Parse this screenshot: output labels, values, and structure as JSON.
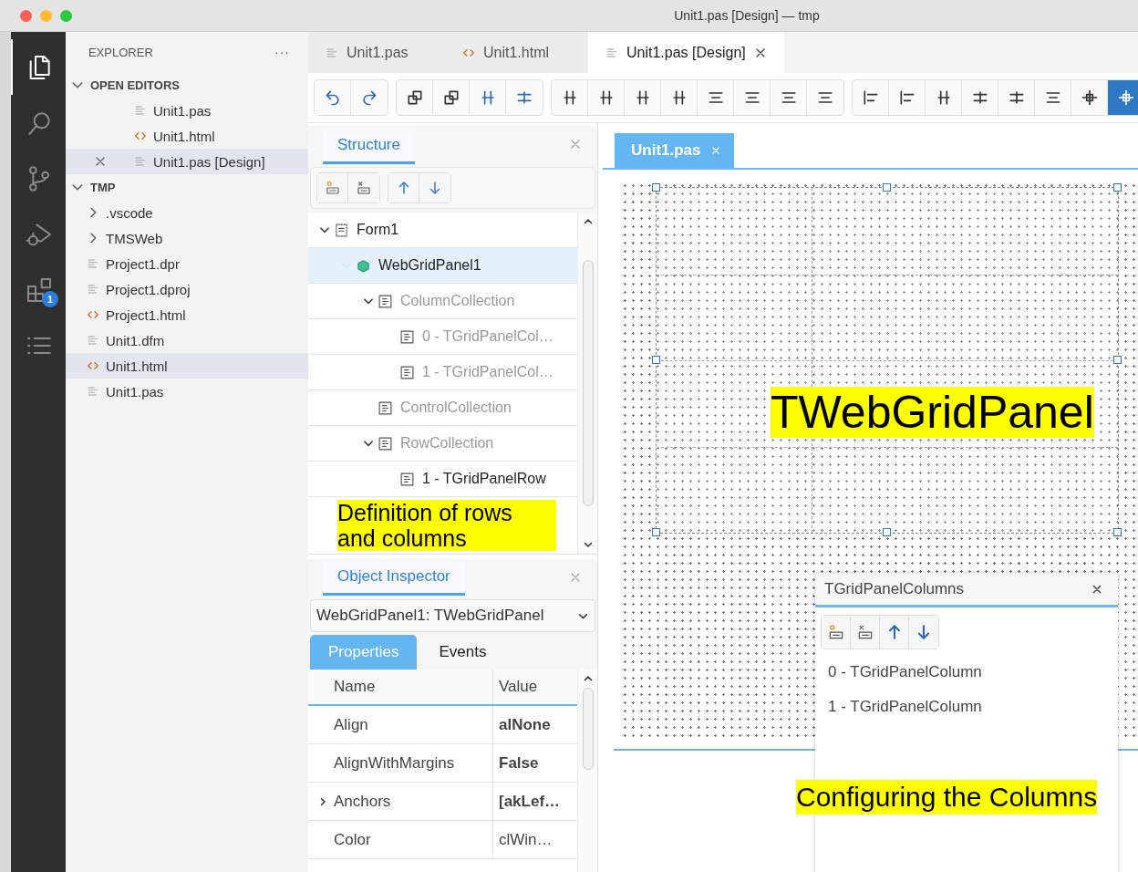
{
  "window": {
    "title": "Unit1.pas [Design] — tmp"
  },
  "activity_bar": {
    "items": [
      {
        "selected": true
      },
      {
        "selected": false
      },
      {
        "selected": false
      },
      {
        "selected": false
      },
      {
        "selected": false,
        "badge": "1"
      },
      {
        "selected": false
      }
    ]
  },
  "explorer": {
    "title": "EXPLORER",
    "more": "···",
    "sections": [
      {
        "kind": "editors",
        "title": "OPEN EDITORS",
        "expanded": true,
        "items": [
          {
            "kind": "file",
            "name": "Unit1.pas",
            "selected": false
          },
          {
            "kind": "html",
            "name": "Unit1.html",
            "selected": false
          },
          {
            "kind": "file",
            "name": "Unit1.pas [Design]",
            "selected": true
          }
        ]
      },
      {
        "kind": "folder",
        "title": "TMP",
        "expanded": true,
        "items": [
          {
            "kind": "folder",
            "name": ".vscode",
            "selected": false
          },
          {
            "kind": "folder",
            "name": "TMSWeb",
            "selected": false
          },
          {
            "kind": "file",
            "name": "Project1.dpr",
            "selected": false
          },
          {
            "kind": "file",
            "name": "Project1.dproj",
            "selected": false
          },
          {
            "kind": "html",
            "name": "Project1.html",
            "selected": false
          },
          {
            "kind": "file",
            "name": "Unit1.dfm",
            "selected": false
          },
          {
            "kind": "html",
            "name": "Unit1.html",
            "selected": true
          },
          {
            "kind": "file",
            "name": "Unit1.pas",
            "selected": false
          }
        ]
      }
    ]
  },
  "editor_tabs": [
    {
      "kind": "file",
      "label": "Unit1.pas",
      "selected": false
    },
    {
      "kind": "html",
      "label": "Unit1.html",
      "selected": false
    },
    {
      "kind": "file",
      "label": "Unit1.pas [Design]",
      "selected": true
    }
  ],
  "toolbar": {
    "groups": [
      {
        "buttons": [
          {
            "selected": false
          },
          {
            "selected": false
          }
        ]
      },
      {
        "buttons": [
          {
            "selected": false
          },
          {
            "selected": false
          },
          {
            "selected": false
          },
          {
            "selected": false
          }
        ]
      },
      {
        "buttons": [
          {
            "selected": false
          },
          {
            "selected": false
          },
          {
            "selected": false
          },
          {
            "selected": false
          },
          {
            "selected": false
          },
          {
            "selected": false
          },
          {
            "selected": false
          },
          {
            "selected": false
          }
        ]
      },
      {
        "buttons": [
          {
            "selected": false
          },
          {
            "selected": false
          },
          {
            "selected": false
          },
          {
            "selected": false
          },
          {
            "selected": false
          },
          {
            "selected": false
          },
          {
            "selected": false
          },
          {
            "selected": true
          }
        ]
      }
    ]
  },
  "structure": {
    "tab": "Structure",
    "tree": [
      {
        "label": "Form1",
        "kind": "form",
        "expanded": true,
        "selected": false,
        "greyed": false,
        "children": [
          {
            "label": "WebGridPanel1",
            "kind": "panel",
            "expanded": true,
            "selected": true,
            "greyed": false,
            "children": [
              {
                "label": "ColumnCollection",
                "kind": "collection",
                "expanded": true,
                "selected": false,
                "greyed": true,
                "children": [
                  {
                    "label": "0 - TGridPanelCol…",
                    "kind": "collection",
                    "selected": false,
                    "greyed": true
                  },
                  {
                    "label": "1 - TGridPanelCol…",
                    "kind": "collection",
                    "selected": false,
                    "greyed": true
                  }
                ]
              },
              {
                "label": "ControlCollection",
                "kind": "collection",
                "selected": false,
                "greyed": true
              },
              {
                "label": "RowCollection",
                "kind": "collection",
                "expanded": true,
                "selected": false,
                "greyed": true,
                "children": [
                  {
                    "label": "1 - TGridPanelRow",
                    "kind": "collection",
                    "selected": false,
                    "greyed": false
                  }
                ]
              }
            ]
          }
        ]
      }
    ],
    "annotation": "Definition of rows and columns"
  },
  "inspector": {
    "tab": "Object Inspector",
    "component": "WebGridPanel1: TWebGridPanel",
    "tabs": [
      {
        "label": "Properties",
        "selected": true
      },
      {
        "label": "Events",
        "selected": false
      }
    ],
    "columns": [
      "Name",
      "Value"
    ],
    "rows": [
      {
        "name": "Align",
        "value": "alNone",
        "bold": true,
        "expandable": false
      },
      {
        "name": "AlignWithMargins",
        "value": "False",
        "bold": true,
        "expandable": false
      },
      {
        "name": "Anchors",
        "value": "[akLef…",
        "bold": true,
        "expandable": true
      },
      {
        "name": "Color",
        "value": "clWin…",
        "bold": false,
        "expandable": false
      }
    ]
  },
  "designer": {
    "tabs": [
      {
        "label": "Unit1.pas",
        "selected": true
      }
    ],
    "panel_caption": "TWebGridPanel",
    "columns_dialog": {
      "title": "TGridPanelColumns",
      "items": [
        "0 - TGridPanelColumn",
        "1 - TGridPanelColumn"
      ]
    },
    "annotation": "Configuring the Columns"
  }
}
